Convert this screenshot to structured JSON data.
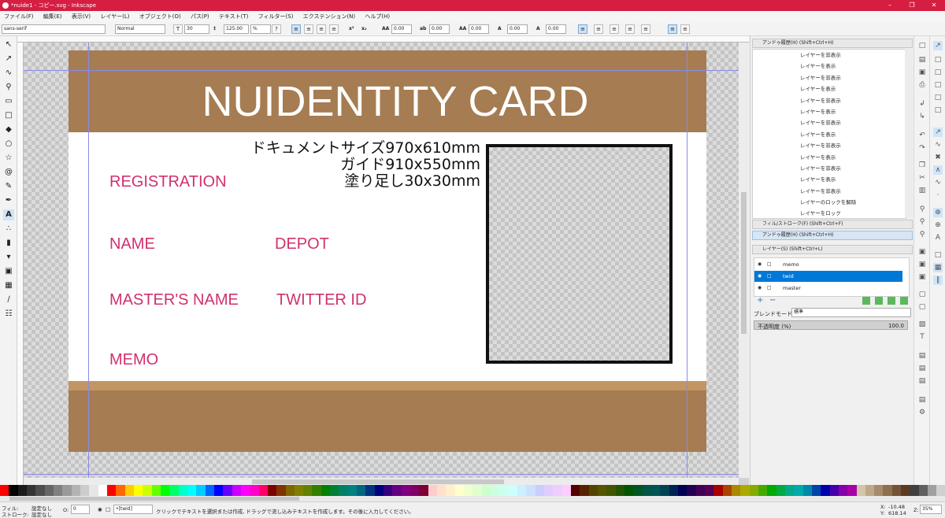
{
  "window": {
    "title": "*nuide1 - コピー.svg - Inkscape"
  },
  "menu": [
    "ファイル(F)",
    "編集(E)",
    "表示(V)",
    "レイヤー(L)",
    "オブジェクト(O)",
    "パス(P)",
    "テキスト(T)",
    "フィルター(S)",
    "エクステンション(N)",
    "ヘルプ(H)"
  ],
  "text_toolbar": {
    "font_family": "sans-serif",
    "font_style": "Normal",
    "font_size": "30",
    "line_spacing": "125.00",
    "unit": "%",
    "letter_spacing": "0.00",
    "word_spacing": "0.00",
    "kern_h": "0.00",
    "kern_v": "0.00",
    "rotation": "0.00"
  },
  "card": {
    "title": "NUIDENTITY CARD",
    "fields": {
      "registration": "REGISTRATION",
      "name": "NAME",
      "depot": "DEPOT",
      "master_name": "MASTER'S  NAME",
      "twitter_id": "TWITTER ID",
      "memo": "MEMO"
    },
    "info_lines": [
      "ドキュメントサイズ970x610mm",
      "ガイド910x550mm",
      "塗り足し30x30mm"
    ],
    "colors": {
      "band": "#a67c52",
      "stripe": "#c39563",
      "label": "#d1306d"
    }
  },
  "dock": {
    "undo_header": "アンドゥ履歴(H) (Shift+Ctrl+H)",
    "history": [
      "レイヤーを非表示",
      "レイヤーを表示",
      "レイヤーを非表示",
      "レイヤーを表示",
      "レイヤーを非表示",
      "レイヤーを表示",
      "レイヤーを非表示",
      "レイヤーを表示",
      "レイヤーを非表示",
      "レイヤーを表示",
      "レイヤーを非表示",
      "レイヤーを表示",
      "レイヤーを非表示",
      "レイヤーのロックを解除",
      "レイヤーをロック"
    ],
    "fill_stroke_header": "フィル/ストローク(F) (Shift+Ctrl+F)",
    "undo_header_2": "アンドゥ履歴(H) (Shift+Ctrl+H)",
    "layers_header": "レイヤー(S) (Shift+Ctrl+L)",
    "layers": [
      "memo",
      "twid",
      "master"
    ],
    "selected_layer": "twid",
    "blend_label": "ブレンドモード:",
    "blend_value": "標準",
    "opacity_label": "不透明度 (%)",
    "opacity_value": "100.0"
  },
  "status": {
    "fill_label": "フィル:",
    "stroke_label": "ストローク:",
    "fill_value": "設定なし",
    "stroke_value": "設定なし",
    "opacity_label": "O:",
    "opacity_value": "0",
    "layer": "•[twid]",
    "message": "クリックでテキストを選択または作成, ドラッグで流し込みテキストを作成します。その後に入力してください。",
    "x_label": "X:",
    "y_label": "Y:",
    "x": "-10.48",
    "y": "618.14",
    "zoom_label": "Z:",
    "zoom": "35%"
  },
  "palette": [
    "#ff0000",
    "#000000",
    "#1a1a1a",
    "#333333",
    "#4d4d4d",
    "#666666",
    "#808080",
    "#999999",
    "#b3b3b3",
    "#cccccc",
    "#e6e6e6",
    "#ffffff",
    "#ff0000",
    "#ff6600",
    "#ffcc00",
    "#ffff00",
    "#ccff00",
    "#66ff00",
    "#00ff00",
    "#00ff66",
    "#00ffcc",
    "#00ffff",
    "#00ccff",
    "#0066ff",
    "#0000ff",
    "#6600ff",
    "#cc00ff",
    "#ff00ff",
    "#ff00cc",
    "#ff0066",
    "#800000",
    "#803300",
    "#806600",
    "#808000",
    "#668000",
    "#338000",
    "#008000",
    "#008033",
    "#008066",
    "#008080",
    "#006680",
    "#003380",
    "#000080",
    "#330080",
    "#660080",
    "#800080",
    "#800066",
    "#800033",
    "#ffcccc",
    "#ffe0cc",
    "#fff0cc",
    "#ffffcc",
    "#f0ffcc",
    "#e0ffcc",
    "#ccffcc",
    "#ccffe0",
    "#ccfff0",
    "#ccffff",
    "#ccf0ff",
    "#cce0ff",
    "#ccccff",
    "#e0ccff",
    "#f0ccff",
    "#ffccff",
    "#550000",
    "#552200",
    "#554400",
    "#555500",
    "#445500",
    "#225500",
    "#005500",
    "#005522",
    "#005544",
    "#005555",
    "#004455",
    "#002255",
    "#000055",
    "#220055",
    "#440055",
    "#550055",
    "#aa0000",
    "#aa4400",
    "#aa8800",
    "#aaaa00",
    "#88aa00",
    "#44aa00",
    "#00aa00",
    "#00aa44",
    "#00aa88",
    "#00aaaa",
    "#0088aa",
    "#0044aa",
    "#0000aa",
    "#4400aa",
    "#8800aa",
    "#aa00aa",
    "#d4c4a8",
    "#bfa888",
    "#a68c6c",
    "#8c7050",
    "#735438",
    "#5a3c24",
    "#404040",
    "#606060",
    "#a0a0a0",
    "#d0d0d0"
  ]
}
